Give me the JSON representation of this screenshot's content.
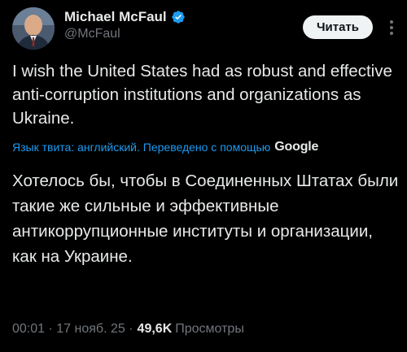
{
  "author": {
    "display_name": "Michael McFaul",
    "handle": "@McFaul",
    "verified": true
  },
  "actions": {
    "follow_label": "Читать"
  },
  "tweet": {
    "text": "I wish the United States had as robust and effective anti-corruption institutions and organizations as Ukraine.",
    "translation_info": "Язык твита: английский. Переведено с помощью",
    "translation_provider": "Google",
    "translated_text": "Хотелось бы, чтобы в Соединенных Штатах были такие же сильные и эффективные антикоррупционные институты и организации, как на Украине.",
    "time": "00:01",
    "date": "17 нояб. 25",
    "views_count": "49,6K",
    "views_label": "Просмотры"
  },
  "colors": {
    "background": "#000000",
    "text": "#e7e9ea",
    "secondary": "#71767b",
    "link": "#1d9bf0",
    "verified": "#1d9bf0"
  }
}
